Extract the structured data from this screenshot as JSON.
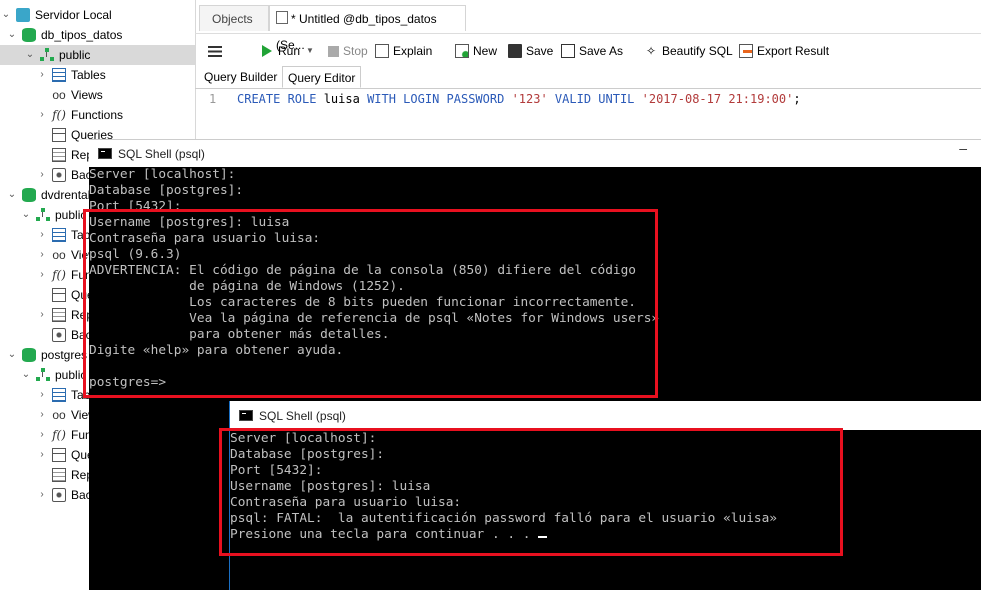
{
  "tree": {
    "nodes": [
      {
        "label": "Servidor Local"
      },
      {
        "label": "db_tipos_datos"
      },
      {
        "label": "public"
      },
      {
        "label": "Tables"
      },
      {
        "label": "Views"
      },
      {
        "label": "Functions"
      },
      {
        "label": "Queries"
      },
      {
        "label": "Reports"
      },
      {
        "label": "Backups"
      },
      {
        "label": "dvdrental"
      },
      {
        "label": "public"
      },
      {
        "label": "Tables"
      },
      {
        "label": "Views"
      },
      {
        "label": "Functions"
      },
      {
        "label": "Queries"
      },
      {
        "label": "Reports"
      },
      {
        "label": "Backups"
      },
      {
        "label": "postgres"
      },
      {
        "label": "public"
      },
      {
        "label": "Tables"
      },
      {
        "label": "Views"
      },
      {
        "label": "Functions"
      },
      {
        "label": "Queries"
      },
      {
        "label": "Reports"
      },
      {
        "label": "Backups"
      }
    ]
  },
  "tabs": {
    "objects": "Objects",
    "untitled": "* Untitled @db_tipos_datos (Se..."
  },
  "toolbar": {
    "run": "Run",
    "stop": "Stop",
    "explain": "Explain",
    "new": "New",
    "save": "Save",
    "save_as": "Save As",
    "beautify": "Beautify SQL",
    "export": "Export Result"
  },
  "subtabs": {
    "builder": "Query Builder",
    "editor": "Query Editor"
  },
  "editor": {
    "line_number": "1",
    "kw1": "CREATE ROLE",
    "ident": " luisa ",
    "kw2": "WITH LOGIN PASSWORD",
    "str1": " '123' ",
    "kw3": "VALID UNTIL",
    "str2": " '2017-08-17 21:19:00'",
    "end": ";"
  },
  "shell1": {
    "title": "SQL Shell (psql)",
    "lines": [
      "Server [localhost]:",
      "Database [postgres]:",
      "Port [5432]:",
      "Username [postgres]: luisa",
      "Contraseña para usuario luisa:",
      "psql (9.6.3)",
      "ADVERTENCIA: El código de página de la consola (850) difiere del código",
      "             de página de Windows (1252).",
      "             Los caracteres de 8 bits pueden funcionar incorrectamente.",
      "             Vea la página de referencia de psql «Notes for Windows users»",
      "             para obtener más detalles.",
      "Digite «help» para obtener ayuda.",
      "",
      "postgres=>"
    ]
  },
  "shell2": {
    "title": "SQL Shell (psql)",
    "lines": [
      "Server [localhost]:",
      "Database [postgres]:",
      "Port [5432]:",
      "Username [postgres]: luisa",
      "Contraseña para usuario luisa:",
      "psql: FATAL:  la autentificación password falló para el usuario «luisa»",
      "Presione una tecla para continuar . . . "
    ]
  },
  "colors": {
    "highlight": "#e8101f",
    "keyword": "#2b5ab8",
    "string": "#b23b3b",
    "console_text": "#c0c0c0"
  }
}
